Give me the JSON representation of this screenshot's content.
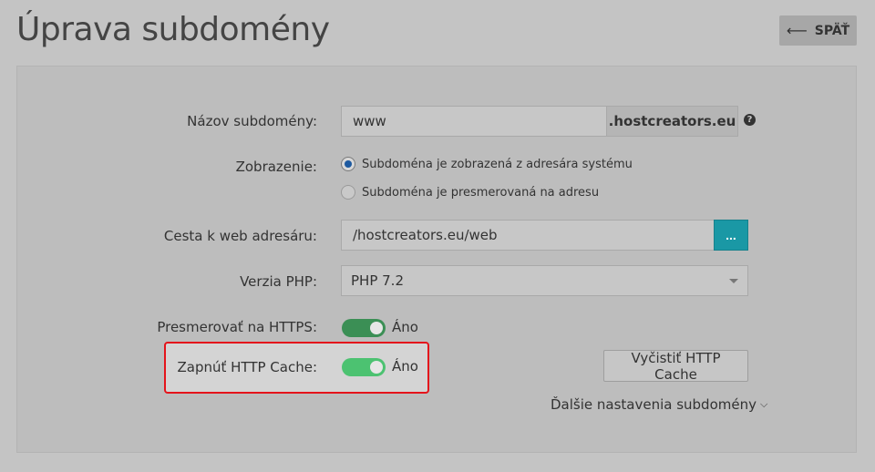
{
  "header": {
    "title": "Úprava subdomény",
    "back_label": "SPÄŤ"
  },
  "form": {
    "subdomain": {
      "label": "Názov subdomény:",
      "value": "www",
      "suffix": ".hostcreators.eu",
      "help": "?"
    },
    "display": {
      "label": "Zobrazenie:",
      "options": [
        {
          "label": "Subdoména je zobrazená z adresára systému",
          "checked": true
        },
        {
          "label": "Subdoména je presmerovaná na adresu",
          "checked": false
        }
      ]
    },
    "web_path": {
      "label": "Cesta k web adresáru:",
      "value": "/hostcreators.eu/web",
      "browse_label": "..."
    },
    "php": {
      "label": "Verzia PHP:",
      "selected": "PHP 7.2"
    },
    "https": {
      "label": "Presmerovať na HTTPS:",
      "on": true,
      "state_label": "Áno",
      "color": "#3b8f55"
    },
    "http_cache": {
      "label": "Zapnúť HTTP Cache:",
      "on": true,
      "state_label": "Áno",
      "color": "#4cc271"
    },
    "clear_cache_label": "Vyčistiť HTTP Cache",
    "more_settings_label": "Ďalšie nastavenia subdomény"
  },
  "colors": {
    "accent": "#1a98a5",
    "highlight": "#e4141b",
    "radio_selected": "#1e5aa0"
  }
}
